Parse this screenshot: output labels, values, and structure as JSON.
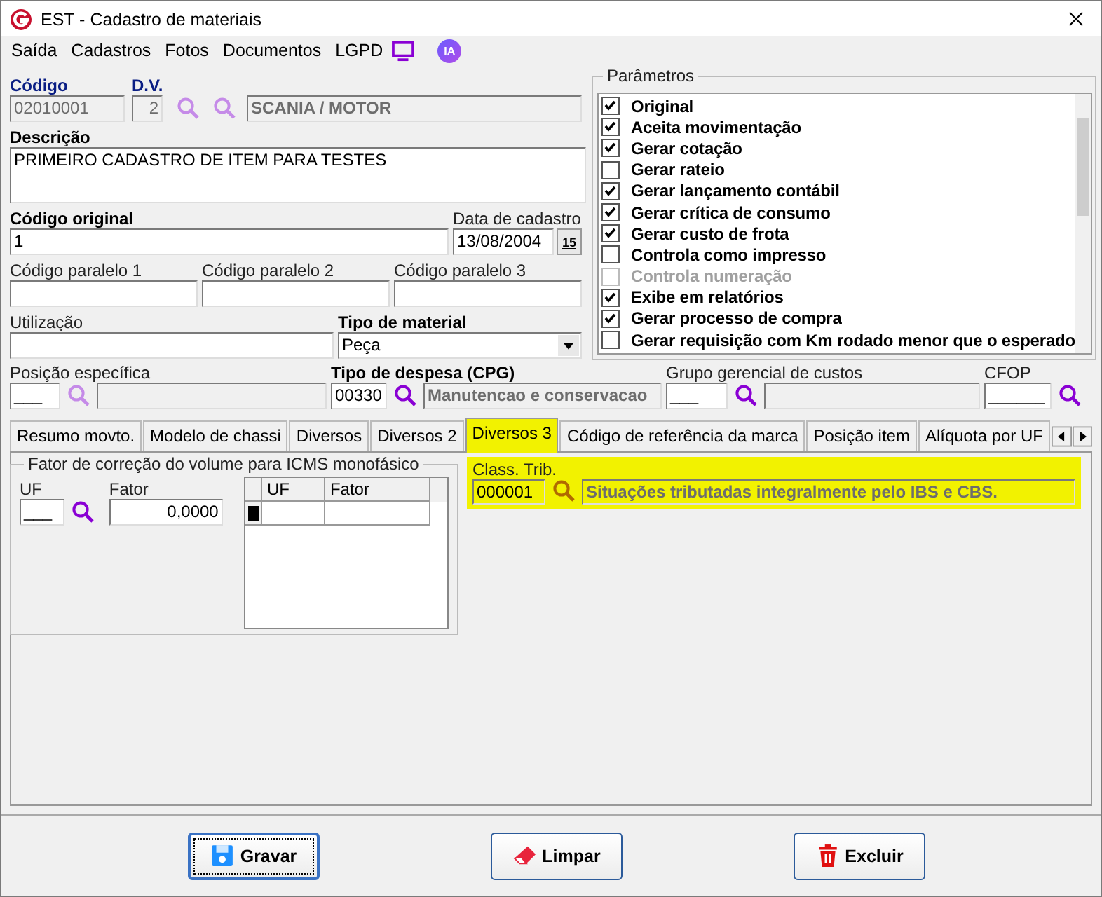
{
  "window": {
    "title": "EST - Cadastro de materiais"
  },
  "menu": [
    "Saída",
    "Cadastros",
    "Fotos",
    "Documentos",
    "LGPD"
  ],
  "assistant_badge": "IA",
  "fields": {
    "codigo": {
      "label": "Código",
      "label_bold": true,
      "key_field": true,
      "value": "02010001",
      "disabled": true
    },
    "dv": {
      "label": "D.V.",
      "label_bold": true,
      "key_field": true,
      "value": "2",
      "disabled": true
    },
    "grupo": {
      "value": "SCANIA / MOTOR",
      "disabled": true
    },
    "descricao": {
      "label": "Descrição",
      "label_bold": true,
      "key_field": false,
      "value": "PRIMEIRO CADASTRO DE ITEM PARA TESTES"
    },
    "codigo_original": {
      "label": "Código original",
      "label_bold": true,
      "key_field": false,
      "value": "1"
    },
    "data_cadastro": {
      "label": "Data de cadastro",
      "label_bold": false,
      "key_field": false,
      "value": "13/08/2004",
      "button": "15"
    },
    "paralelo1": {
      "label": "Código paralelo 1",
      "label_bold": false,
      "key_field": false
    },
    "paralelo2": {
      "label": "Código paralelo 2",
      "label_bold": false,
      "key_field": false
    },
    "paralelo3": {
      "label": "Código paralelo 3",
      "label_bold": false,
      "key_field": false
    },
    "utilizacao": {
      "label": "Utilização",
      "label_bold": false,
      "key_field": false
    },
    "tipo_material": {
      "label": "Tipo de material",
      "label_bold": true,
      "key_field": false,
      "value": "Peça"
    },
    "posicao": {
      "label": "Posição específica",
      "label_bold": false,
      "key_field": false,
      "value": "___",
      "search_enabled": false
    },
    "tipo_despesa": {
      "label": "Tipo de despesa (CPG)",
      "label_bold": true,
      "key_field": false,
      "value": "00330",
      "description": "Manutencao e conservacao",
      "search_enabled": true
    },
    "grupo_gerencial": {
      "label": "Grupo gerencial de custos",
      "label_bold": false,
      "key_field": false,
      "value": "___",
      "search_enabled": true
    },
    "cfop": {
      "label": "CFOP",
      "label_bold": false,
      "key_field": false,
      "value": "______",
      "search_enabled": true
    }
  },
  "parametros": {
    "title": "Parâmetros",
    "items": [
      {
        "label": "Original",
        "checked": true,
        "disabled": false
      },
      {
        "label": "Aceita movimentação",
        "checked": true,
        "disabled": false
      },
      {
        "label": "Gerar cotação",
        "checked": true,
        "disabled": false
      },
      {
        "label": "Gerar rateio",
        "checked": false,
        "disabled": false
      },
      {
        "label": "Gerar lançamento contábil",
        "checked": true,
        "disabled": false
      },
      {
        "label": "Gerar crítica de consumo",
        "checked": true,
        "disabled": false
      },
      {
        "label": "Gerar custo de frota",
        "checked": true,
        "disabled": false
      },
      {
        "label": "Controla como impresso",
        "checked": false,
        "disabled": false
      },
      {
        "label": "Controla numeração",
        "checked": false,
        "disabled": true
      },
      {
        "label": "Exibe em relatórios",
        "checked": true,
        "disabled": false
      },
      {
        "label": "Gerar processo de compra",
        "checked": true,
        "disabled": false
      },
      {
        "label": "Gerar requisição com Km rodado menor que o esperado",
        "checked": false,
        "disabled": false
      }
    ]
  },
  "tabs": [
    {
      "label": "Resumo movto.",
      "selected": false,
      "highlighted": false
    },
    {
      "label": "Modelo de chassi",
      "selected": false,
      "highlighted": false
    },
    {
      "label": "Diversos",
      "selected": false,
      "highlighted": false
    },
    {
      "label": "Diversos 2",
      "selected": false,
      "highlighted": false
    },
    {
      "label": "Diversos 3",
      "selected": true,
      "highlighted": true
    },
    {
      "label": "Código de referência da marca",
      "selected": false,
      "highlighted": false
    },
    {
      "label": "Posição item",
      "selected": false,
      "highlighted": false
    },
    {
      "label": "Alíquota por UF",
      "selected": false,
      "highlighted": false
    }
  ],
  "diversos3": {
    "fator_group": {
      "title": "Fator de correção do volume para ICMS monofásico",
      "uf_label": "UF",
      "uf_value": "___",
      "fator_label": "Fator",
      "fator_value": "0,0000",
      "grid_columns": [
        "UF",
        "Fator"
      ]
    },
    "class_trib": {
      "label": "Class. Trib.",
      "code": "000001",
      "description": "Situações tributadas integralmente pelo IBS e CBS.",
      "highlighted": true
    }
  },
  "buttons": [
    {
      "label": "Gravar",
      "kind": "save",
      "default": true
    },
    {
      "label": "Limpar",
      "kind": "clear",
      "default": false
    },
    {
      "label": "Excluir",
      "kind": "delete",
      "default": false
    }
  ]
}
